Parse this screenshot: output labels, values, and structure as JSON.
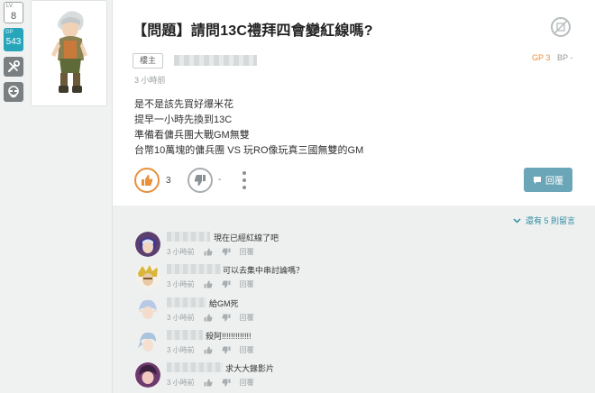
{
  "left_rail": {
    "lv_label": "LV.",
    "lv_value": "8",
    "gp_label": "GP",
    "gp_value": "543",
    "icons": [
      "tools-icon",
      "guild-icon"
    ]
  },
  "post": {
    "title": "【問題】請問13C禮拜四會變紅線嗎?",
    "author_badge": "樓主",
    "gp_text": "GP 3",
    "bp_text": "BP -",
    "time": "3 小時前",
    "body_lines": [
      "是不是該先買好爆米花",
      "提早一小時先換到13C",
      "準備看傭兵團大戰GM無雙",
      "台幣10萬塊的傭兵團 VS 玩RO像玩真三國無雙的GM"
    ],
    "like_count": "3",
    "dislike_count": "-",
    "reply_label": "回覆"
  },
  "comments": {
    "more_label": "還有 5 則留言",
    "items": [
      {
        "text": "現在已經紅線了吧",
        "time": "3 小時前",
        "reply": "回覆"
      },
      {
        "text": "可以去集中串討論嗎？",
        "time": "3 小時前",
        "reply": "回覆"
      },
      {
        "text": "給GM死",
        "time": "3 小時前",
        "reply": "回覆"
      },
      {
        "text": "殺阿!!!!!!!!!!!!!",
        "time": "3 小時前",
        "reply": "回覆"
      },
      {
        "text": "求大大錄影片",
        "time": "3 小時前",
        "reply": "回覆"
      }
    ]
  },
  "colors": {
    "accent_orange": "#e8903a",
    "teal": "#27a6bb",
    "reply_button": "#6ba6b8"
  }
}
